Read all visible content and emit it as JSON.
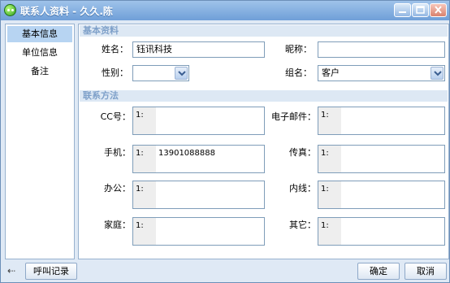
{
  "window": {
    "title": "联系人资料 - 久久.陈",
    "minimize_icon": "minimize-icon",
    "maximize_icon": "maximize-icon",
    "close_icon": "close-icon"
  },
  "nav": {
    "items": [
      {
        "label": "基本信息",
        "active": true
      },
      {
        "label": "单位信息",
        "active": false
      },
      {
        "label": "备注",
        "active": false
      }
    ]
  },
  "basic": {
    "section_title": "基本资料",
    "name_label": "姓名：",
    "name_value": "钰讯科技",
    "nickname_label": "昵称：",
    "nickname_value": "",
    "gender_label": "性别：",
    "gender_value": "",
    "group_label": "组名：",
    "group_value": "客户"
  },
  "contact": {
    "section_title": "联系方法",
    "fields": [
      {
        "label": "CC号：",
        "line": "1:",
        "value": ""
      },
      {
        "label": "电子邮件：",
        "line": "1:",
        "value": ""
      },
      {
        "label": "手机：",
        "line": "1:",
        "value": "13901088888"
      },
      {
        "label": "传真：",
        "line": "1:",
        "value": ""
      },
      {
        "label": "办公：",
        "line": "1:",
        "value": ""
      },
      {
        "label": "内线：",
        "line": "1:",
        "value": ""
      },
      {
        "label": "家庭：",
        "line": "1:",
        "value": ""
      },
      {
        "label": "其它：",
        "line": "1:",
        "value": ""
      }
    ]
  },
  "footer": {
    "back_icon": "back-arrow-icon",
    "back_glyph": "⇠",
    "call_log_label": "呼叫记录",
    "ok_label": "确定",
    "cancel_label": "取消"
  },
  "colors": {
    "title_bar": "#7ba8dd",
    "section_text": "#7ea0c9",
    "nav_active": "#b7d4f2"
  }
}
